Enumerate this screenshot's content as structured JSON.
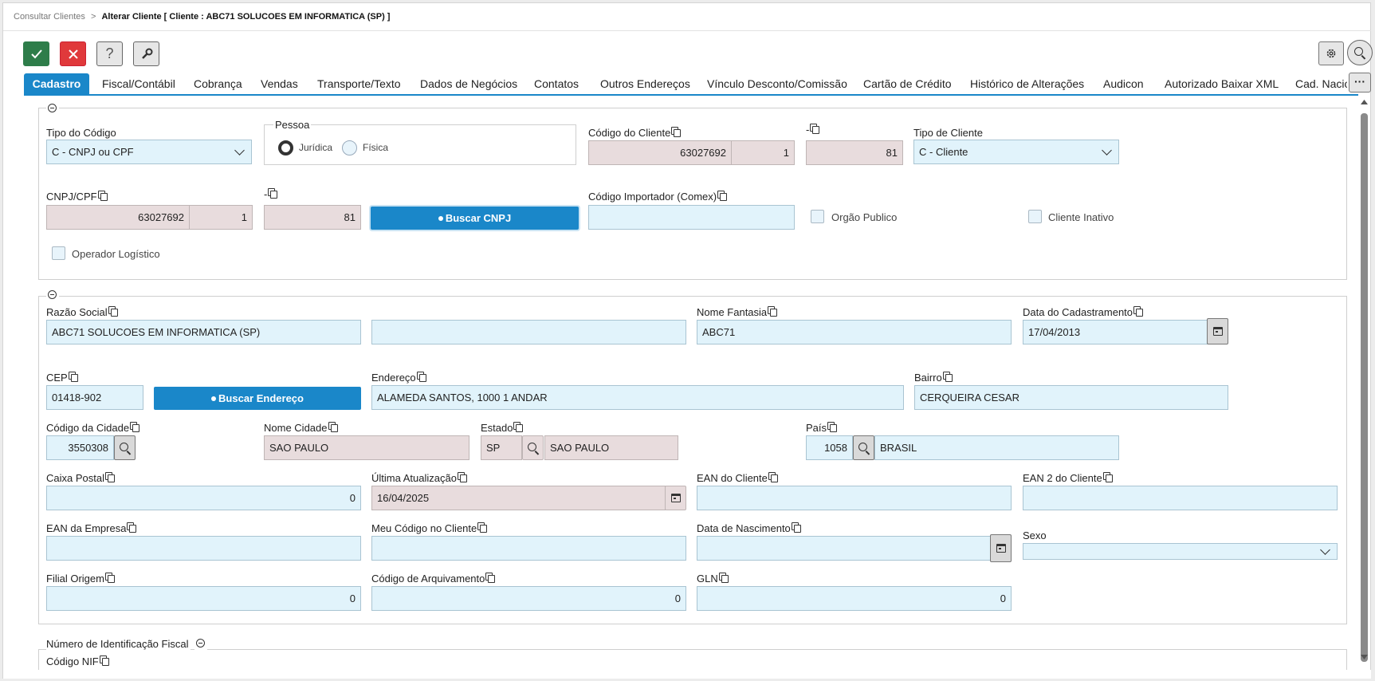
{
  "breadcrumb": {
    "parent": "Consultar Clientes",
    "separator": ">",
    "current": "Alterar Cliente [ Cliente : ABC71 SOLUCOES EM INFORMATICA (SP) ]"
  },
  "toolbar": {
    "confirm_icon": "check-icon",
    "cancel_icon": "close-icon",
    "help_label": "?",
    "tools_icon": "wrench-icon"
  },
  "tabs": [
    "Cadastro",
    "Fiscal/Contábil",
    "Cobrança",
    "Vendas",
    "Transporte/Texto",
    "Dados de Negócios",
    "Contatos",
    "Outros Endereços",
    "Vínculo Desconto/Comissão",
    "Cartão de Crédito",
    "Histórico de Alterações",
    "Audicon",
    "Autorizado Baixar XML",
    "Cad. Nacio"
  ],
  "more_label": "···",
  "section1": {
    "tipo_codigo": {
      "label": "Tipo do Código",
      "value": "C - CNPJ ou CPF"
    },
    "pessoa": {
      "legend": "Pessoa",
      "juridica": "Jurídica",
      "fisica": "Física",
      "selected": "Jurídica"
    },
    "codigo_cliente": {
      "label": "Código do Cliente",
      "value1": "63027692",
      "value2": "1"
    },
    "dash1": {
      "label": "-",
      "value": "81"
    },
    "tipo_cliente": {
      "label": "Tipo de Cliente",
      "value": "C - Cliente"
    },
    "cnpj": {
      "label": "CNPJ/CPF",
      "value1": "63027692",
      "value2": "1"
    },
    "dash2": {
      "label": "-",
      "value": "81"
    },
    "buscar_cnpj": "Buscar CNPJ",
    "codigo_importador": {
      "label": "Código Importador (Comex)",
      "value": ""
    },
    "orgao_publico": "Orgão Publico",
    "cliente_inativo": "Cliente Inativo",
    "operador_logistico": "Operador Logístico"
  },
  "section2": {
    "razao_social": {
      "label": "Razão Social",
      "value": "ABC71 SOLUCOES EM INFORMATICA (SP)",
      "value2": ""
    },
    "nome_fantasia": {
      "label": "Nome Fantasia",
      "value": "ABC71"
    },
    "data_cadastramento": {
      "label": "Data do Cadastramento",
      "value": "17/04/2013"
    },
    "cep": {
      "label": "CEP",
      "value": "01418-902"
    },
    "buscar_endereco": "Buscar Endereço",
    "endereco": {
      "label": "Endereço",
      "value": "ALAMEDA SANTOS, 1000 1 ANDAR"
    },
    "bairro": {
      "label": "Bairro",
      "value": "CERQUEIRA CESAR"
    },
    "codigo_cidade": {
      "label": "Código da Cidade",
      "value": "3550308"
    },
    "nome_cidade": {
      "label": "Nome Cidade",
      "value": "SAO PAULO"
    },
    "estado": {
      "label": "Estado",
      "uf": "SP",
      "nome": "SAO PAULO"
    },
    "pais": {
      "label": "País",
      "codigo": "1058",
      "nome": "BRASIL"
    },
    "caixa_postal": {
      "label": "Caixa Postal",
      "value": "0"
    },
    "ultima_atualizacao": {
      "label": "Última Atualização",
      "value": "16/04/2025"
    },
    "ean_cliente": {
      "label": "EAN do Cliente",
      "value": ""
    },
    "ean2_cliente": {
      "label": "EAN 2 do Cliente",
      "value": ""
    },
    "ean_empresa": {
      "label": "EAN da Empresa",
      "value": ""
    },
    "meu_codigo": {
      "label": "Meu Código no Cliente",
      "value": ""
    },
    "data_nascimento": {
      "label": "Data de Nascimento",
      "value": ""
    },
    "sexo": {
      "label": "Sexo",
      "value": ""
    },
    "filial_origem": {
      "label": "Filial Origem",
      "value": "0"
    },
    "codigo_arquivamento": {
      "label": "Código de Arquivamento",
      "value": "0"
    },
    "gln": {
      "label": "GLN",
      "value": "0"
    }
  },
  "section3": {
    "legend": "Número de Identificação Fiscal",
    "codigo_nif": "Código NIF"
  },
  "colors": {
    "accent": "#1a87c9",
    "input_bg": "#e1f3fb",
    "readonly_bg": "#e8dcdd",
    "confirm": "#2e7d4a",
    "cancel": "#e0393b"
  }
}
